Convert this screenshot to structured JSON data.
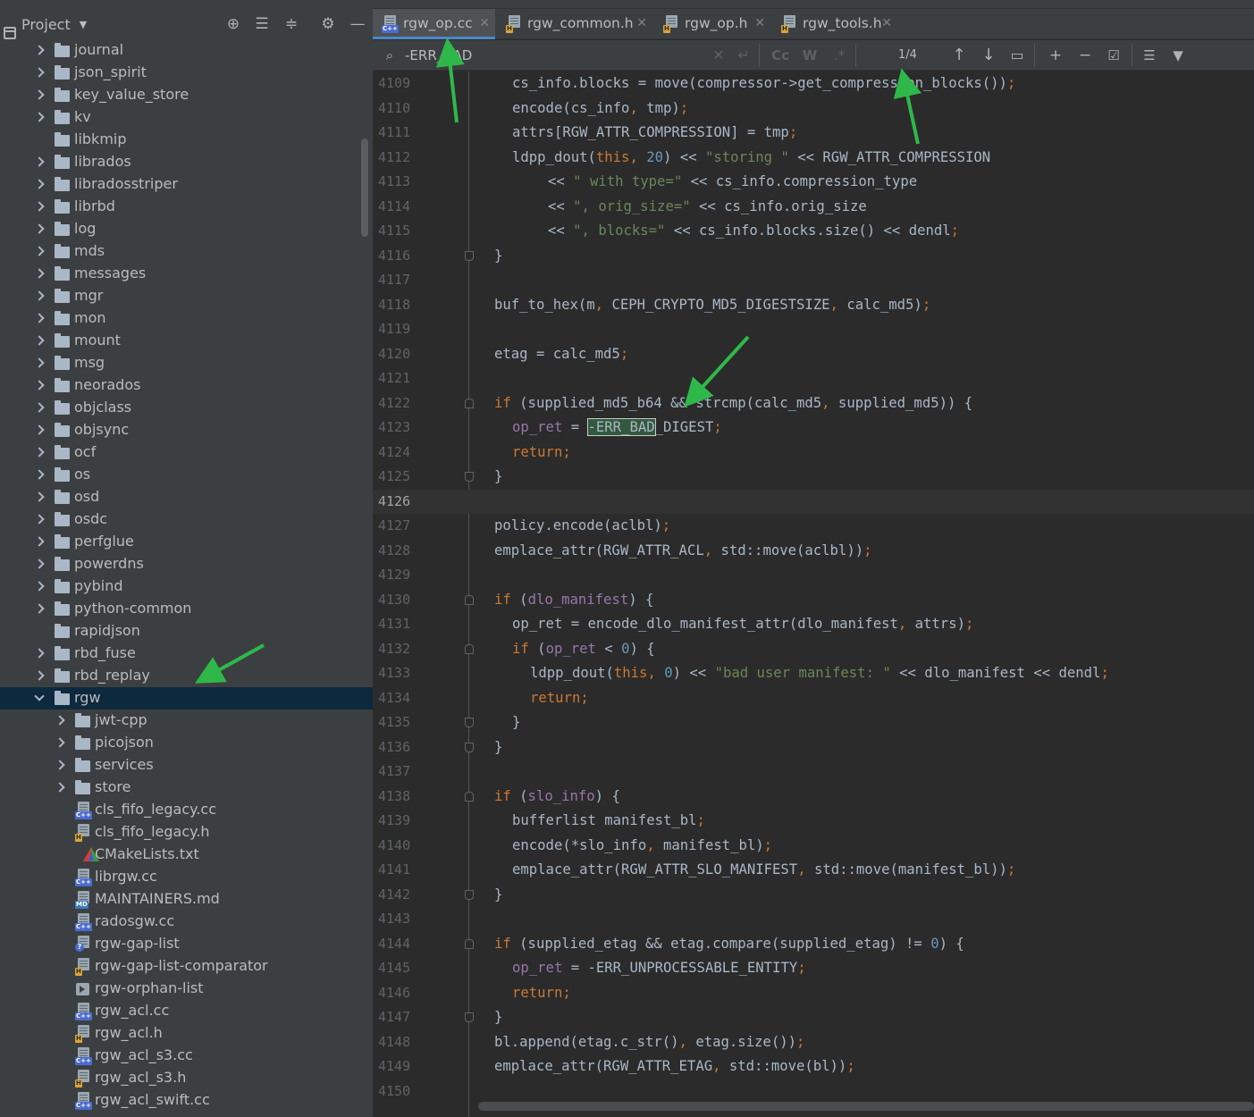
{
  "project_panel": {
    "title": "Project",
    "tree": [
      {
        "label": "journal",
        "type": "folder",
        "expandable": true,
        "depth": 0
      },
      {
        "label": "json_spirit",
        "type": "folder",
        "expandable": true,
        "depth": 0
      },
      {
        "label": "key_value_store",
        "type": "folder",
        "expandable": true,
        "depth": 0
      },
      {
        "label": "kv",
        "type": "folder",
        "expandable": true,
        "depth": 0
      },
      {
        "label": "libkmip",
        "type": "folder",
        "expandable": false,
        "depth": 0
      },
      {
        "label": "librados",
        "type": "folder",
        "expandable": true,
        "depth": 0
      },
      {
        "label": "libradosstriper",
        "type": "folder",
        "expandable": true,
        "depth": 0
      },
      {
        "label": "librbd",
        "type": "folder",
        "expandable": true,
        "depth": 0
      },
      {
        "label": "log",
        "type": "folder",
        "expandable": true,
        "depth": 0
      },
      {
        "label": "mds",
        "type": "folder",
        "expandable": true,
        "depth": 0
      },
      {
        "label": "messages",
        "type": "folder",
        "expandable": true,
        "depth": 0
      },
      {
        "label": "mgr",
        "type": "folder",
        "expandable": true,
        "depth": 0
      },
      {
        "label": "mon",
        "type": "folder",
        "expandable": true,
        "depth": 0
      },
      {
        "label": "mount",
        "type": "folder",
        "expandable": true,
        "depth": 0
      },
      {
        "label": "msg",
        "type": "folder",
        "expandable": true,
        "depth": 0
      },
      {
        "label": "neorados",
        "type": "folder",
        "expandable": true,
        "depth": 0
      },
      {
        "label": "objclass",
        "type": "folder",
        "expandable": true,
        "depth": 0
      },
      {
        "label": "objsync",
        "type": "folder",
        "expandable": true,
        "depth": 0
      },
      {
        "label": "ocf",
        "type": "folder",
        "expandable": true,
        "depth": 0
      },
      {
        "label": "os",
        "type": "folder",
        "expandable": true,
        "depth": 0
      },
      {
        "label": "osd",
        "type": "folder",
        "expandable": true,
        "depth": 0
      },
      {
        "label": "osdc",
        "type": "folder",
        "expandable": true,
        "depth": 0
      },
      {
        "label": "perfglue",
        "type": "folder",
        "expandable": true,
        "depth": 0
      },
      {
        "label": "powerdns",
        "type": "folder",
        "expandable": true,
        "depth": 0
      },
      {
        "label": "pybind",
        "type": "folder",
        "expandable": true,
        "depth": 0
      },
      {
        "label": "python-common",
        "type": "folder",
        "expandable": true,
        "depth": 0
      },
      {
        "label": "rapidjson",
        "type": "folder",
        "expandable": false,
        "depth": 0
      },
      {
        "label": "rbd_fuse",
        "type": "folder",
        "expandable": true,
        "depth": 0
      },
      {
        "label": "rbd_replay",
        "type": "folder",
        "expandable": true,
        "depth": 0
      },
      {
        "label": "rgw",
        "type": "folder",
        "expandable": true,
        "open": true,
        "selected": true,
        "depth": 0
      },
      {
        "label": "jwt-cpp",
        "type": "folder",
        "expandable": true,
        "depth": 1
      },
      {
        "label": "picojson",
        "type": "folder",
        "expandable": true,
        "depth": 1
      },
      {
        "label": "services",
        "type": "folder",
        "expandable": true,
        "depth": 1
      },
      {
        "label": "store",
        "type": "folder",
        "expandable": true,
        "depth": 1
      },
      {
        "label": "cls_fifo_legacy.cc",
        "type": "cpp",
        "depth": 1
      },
      {
        "label": "cls_fifo_legacy.h",
        "type": "h",
        "depth": 1
      },
      {
        "label": "CMakeLists.txt",
        "type": "cmake",
        "depth": 1
      },
      {
        "label": "librgw.cc",
        "type": "cpp",
        "depth": 1
      },
      {
        "label": "MAINTAINERS.md",
        "type": "md",
        "depth": 1
      },
      {
        "label": "radosgw.cc",
        "type": "cpp",
        "depth": 1
      },
      {
        "label": "rgw-gap-list",
        "type": "unknown",
        "depth": 1
      },
      {
        "label": "rgw-gap-list-comparator",
        "type": "h",
        "depth": 1
      },
      {
        "label": "rgw-orphan-list",
        "type": "exec",
        "depth": 1
      },
      {
        "label": "rgw_acl.cc",
        "type": "cpp",
        "depth": 1
      },
      {
        "label": "rgw_acl.h",
        "type": "h",
        "depth": 1
      },
      {
        "label": "rgw_acl_s3.cc",
        "type": "cpp",
        "depth": 1
      },
      {
        "label": "rgw_acl_s3.h",
        "type": "h",
        "depth": 1
      },
      {
        "label": "rgw_acl_swift.cc",
        "type": "cpp",
        "depth": 1
      }
    ]
  },
  "tabs": [
    {
      "label": "rgw_op.cc",
      "type": "cpp",
      "active": true
    },
    {
      "label": "rgw_common.h",
      "type": "h",
      "active": false
    },
    {
      "label": "rgw_op.h",
      "type": "h",
      "active": false
    },
    {
      "label": "rgw_tools.h",
      "type": "h",
      "active": false
    }
  ],
  "find": {
    "query": "-ERR_BAD",
    "match_count": "1/4",
    "match_case_label": "Cc",
    "words_label": "W",
    "regex_label": ".*"
  },
  "editor": {
    "current_line": 4126,
    "lines": [
      {
        "n": 4109,
        "indent": 1,
        "html": "cs_info.blocks = move(compressor->get_compression_blocks())<span class=\"kw\">;</span>"
      },
      {
        "n": 4110,
        "indent": 1,
        "html": "encode(cs_info<span class=\"kw\">,</span> tmp)<span class=\"kw\">;</span>"
      },
      {
        "n": 4111,
        "indent": 1,
        "html": "attrs[RGW_ATTR_COMPRESSION] = tmp<span class=\"kw\">;</span>"
      },
      {
        "n": 4112,
        "indent": 1,
        "html": "ldpp_dout(<span class=\"kw\">this</span><span class=\"kw\">,</span> <span class=\"num\">20</span>) &lt;&lt; <span class=\"str\">\"storing \"</span> &lt;&lt; RGW_ATTR_COMPRESSION"
      },
      {
        "n": 4113,
        "indent": 3,
        "html": "&lt;&lt; <span class=\"str\">\" with type=\"</span> &lt;&lt; cs_info.compression_type"
      },
      {
        "n": 4114,
        "indent": 3,
        "html": "&lt;&lt; <span class=\"str\">\", orig_size=\"</span> &lt;&lt; cs_info.orig_size"
      },
      {
        "n": 4115,
        "indent": 3,
        "html": "&lt;&lt; <span class=\"str\">\", blocks=\"</span> &lt;&lt; cs_info.blocks.size() &lt;&lt; dendl<span class=\"kw\">;</span>"
      },
      {
        "n": 4116,
        "indent": 0,
        "html": "}",
        "fold": "close"
      },
      {
        "n": 4117,
        "indent": 0,
        "html": ""
      },
      {
        "n": 4118,
        "indent": 0,
        "html": "buf_to_hex(m<span class=\"kw\">,</span> CEPH_CRYPTO_MD5_DIGESTSIZE<span class=\"kw\">,</span> calc_md5)<span class=\"kw\">;</span>"
      },
      {
        "n": 4119,
        "indent": 0,
        "html": ""
      },
      {
        "n": 4120,
        "indent": 0,
        "html": "etag = calc_md5<span class=\"kw\">;</span>"
      },
      {
        "n": 4121,
        "indent": 0,
        "html": ""
      },
      {
        "n": 4122,
        "indent": 0,
        "html": "<span class=\"kw\">if</span> (supplied_md5_b64 &amp;&amp; strcmp(calc_md5<span class=\"kw\">,</span> supplied_md5)) {",
        "fold": "open"
      },
      {
        "n": 4123,
        "indent": 1,
        "html": "<span class=\"mem\">op_ret</span> = <span class=\"hl\">-ERR_BAD</span>_DIGEST<span class=\"kw\">;</span>"
      },
      {
        "n": 4124,
        "indent": 1,
        "html": "<span class=\"kw\">return;</span>"
      },
      {
        "n": 4125,
        "indent": 0,
        "html": "}",
        "fold": "close"
      },
      {
        "n": 4126,
        "indent": 0,
        "html": ""
      },
      {
        "n": 4127,
        "indent": 0,
        "html": "policy.encode(aclbl)<span class=\"kw\">;</span>"
      },
      {
        "n": 4128,
        "indent": 0,
        "html": "emplace_attr(RGW_ATTR_ACL<span class=\"kw\">,</span> std::move(aclbl))<span class=\"kw\">;</span>"
      },
      {
        "n": 4129,
        "indent": 0,
        "html": ""
      },
      {
        "n": 4130,
        "indent": 0,
        "html": "<span class=\"kw\">if</span> (<span class=\"mem\">dlo_manifest</span>) {",
        "fold": "open"
      },
      {
        "n": 4131,
        "indent": 1,
        "html": "op_ret = encode_dlo_manifest_attr(dlo_manifest<span class=\"kw\">,</span> attrs)<span class=\"kw\">;</span>"
      },
      {
        "n": 4132,
        "indent": 1,
        "html": "<span class=\"kw\">if</span> (<span class=\"mem\">op_ret</span> &lt; <span class=\"num\">0</span>) {",
        "fold": "open"
      },
      {
        "n": 4133,
        "indent": 2,
        "html": "ldpp_dout(<span class=\"kw\">this</span><span class=\"kw\">,</span> <span class=\"num\">0</span>) &lt;&lt; <span class=\"str\">\"bad user manifest: \"</span> &lt;&lt; dlo_manifest &lt;&lt; dendl<span class=\"kw\">;</span>"
      },
      {
        "n": 4134,
        "indent": 2,
        "html": "<span class=\"kw\">return;</span>"
      },
      {
        "n": 4135,
        "indent": 1,
        "html": "}",
        "fold": "close"
      },
      {
        "n": 4136,
        "indent": 0,
        "html": "}",
        "fold": "close"
      },
      {
        "n": 4137,
        "indent": 0,
        "html": ""
      },
      {
        "n": 4138,
        "indent": 0,
        "html": "<span class=\"kw\">if</span> (<span class=\"mem\">slo_info</span>) {",
        "fold": "open"
      },
      {
        "n": 4139,
        "indent": 1,
        "html": "bufferlist manifest_bl<span class=\"kw\">;</span>"
      },
      {
        "n": 4140,
        "indent": 1,
        "html": "encode(*slo_info<span class=\"kw\">,</span> manifest_bl)<span class=\"kw\">;</span>"
      },
      {
        "n": 4141,
        "indent": 1,
        "html": "emplace_attr(RGW_ATTR_SLO_MANIFEST<span class=\"kw\">,</span> std::move(manifest_bl))<span class=\"kw\">;</span>"
      },
      {
        "n": 4142,
        "indent": 0,
        "html": "}",
        "fold": "close"
      },
      {
        "n": 4143,
        "indent": 0,
        "html": ""
      },
      {
        "n": 4144,
        "indent": 0,
        "html": "<span class=\"kw\">if</span> (supplied_etag &amp;&amp; etag.compare(supplied_etag) != <span class=\"num\">0</span>) {",
        "fold": "open"
      },
      {
        "n": 4145,
        "indent": 1,
        "html": "<span class=\"mem\">op_ret</span> = -ERR_UNPROCESSABLE_ENTITY<span class=\"kw\">;</span>"
      },
      {
        "n": 4146,
        "indent": 1,
        "html": "<span class=\"kw\">return;</span>"
      },
      {
        "n": 4147,
        "indent": 0,
        "html": "}",
        "fold": "close"
      },
      {
        "n": 4148,
        "indent": 0,
        "html": "bl.append(etag.c_str()<span class=\"kw\">,</span> etag.size())<span class=\"kw\">;</span>"
      },
      {
        "n": 4149,
        "indent": 0,
        "html": "emplace_attr(RGW_ATTR_ETAG<span class=\"kw\">,</span> std::move(bl))<span class=\"kw\">;</span>"
      },
      {
        "n": 4150,
        "indent": 0,
        "html": ""
      }
    ]
  },
  "colors": {
    "annotation_arrow": "#2fb84a",
    "selection": "#0d293e",
    "keyword": "#cc7832",
    "string": "#6a8759",
    "number": "#6897bb",
    "member": "#9876aa"
  }
}
